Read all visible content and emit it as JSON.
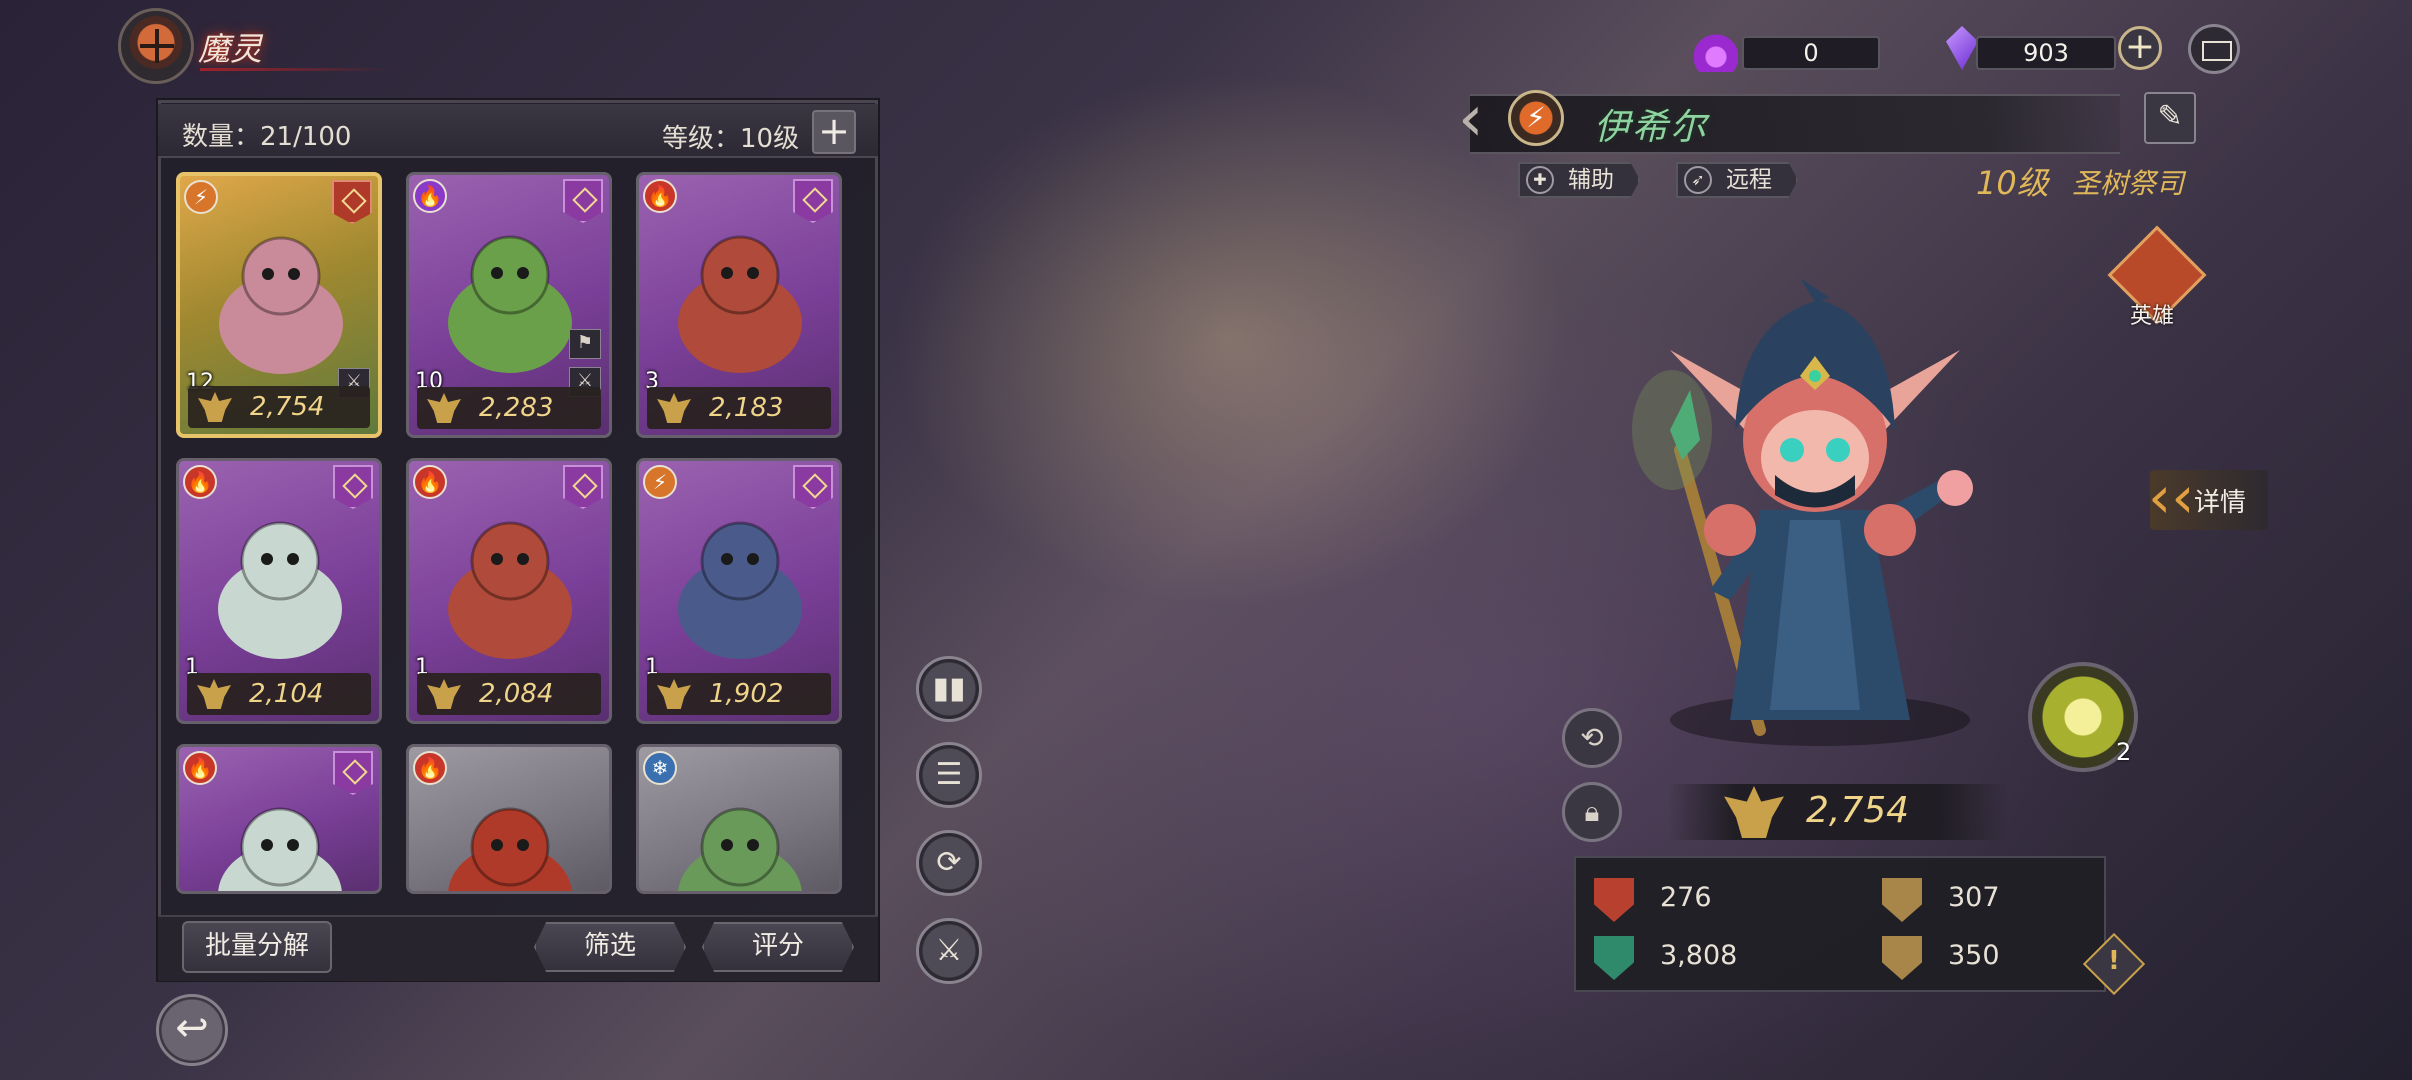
{
  "header": {
    "title": "魔灵"
  },
  "collection": {
    "count_label": "数量：21/100",
    "level_label": "等级：10级",
    "plus_label": "+"
  },
  "cards": [
    {
      "element": "lightning",
      "element_icon": "⚡",
      "level": "12",
      "power": "2,754",
      "selected": true,
      "tags": [
        "⚔"
      ]
    },
    {
      "element": "poison",
      "element_icon": "🔥",
      "level": "10",
      "power": "2,283",
      "selected": false,
      "tags": [
        "⚑",
        "⚔"
      ]
    },
    {
      "element": "fire",
      "element_icon": "🔥",
      "level": "3",
      "power": "2,183",
      "selected": false,
      "tags": []
    },
    {
      "element": "fire",
      "element_icon": "🔥",
      "level": "1",
      "power": "2,104",
      "selected": false,
      "tags": []
    },
    {
      "element": "fire",
      "element_icon": "🔥",
      "level": "1",
      "power": "2,084",
      "selected": false,
      "tags": []
    },
    {
      "element": "lightning",
      "element_icon": "⚡",
      "level": "1",
      "power": "1,902",
      "selected": false,
      "tags": []
    },
    {
      "element": "fire",
      "element_icon": "🔥",
      "level": "",
      "power": "",
      "selected": false,
      "tags": []
    },
    {
      "element": "fire",
      "element_icon": "🔥",
      "level": "",
      "power": "",
      "selected": false,
      "tags": []
    },
    {
      "element": "ice",
      "element_icon": "❄",
      "level": "",
      "power": "",
      "selected": false,
      "tags": []
    }
  ],
  "bottom_bar": {
    "batch_decompose": "批量分解",
    "filter": "筛选",
    "sort": "评分"
  },
  "currencies": {
    "soul_fire": "0",
    "gems": "903"
  },
  "hero": {
    "name": "伊希尔",
    "role_tag": "辅助",
    "range_tag": "远程",
    "level": "10级",
    "class": "圣树祭司",
    "rarity_label": "英雄",
    "detail_label": "详情",
    "power": "2,754",
    "skill_count": "2",
    "stats": {
      "attack": "276",
      "defense": "307",
      "health": "3,808",
      "speed": "350"
    }
  },
  "colors": {
    "accent_gold": "#e0b85a",
    "hero_name": "#8ed4a0",
    "rarity_purple": "#7a3f98",
    "selected_border": "#e7c46a"
  }
}
